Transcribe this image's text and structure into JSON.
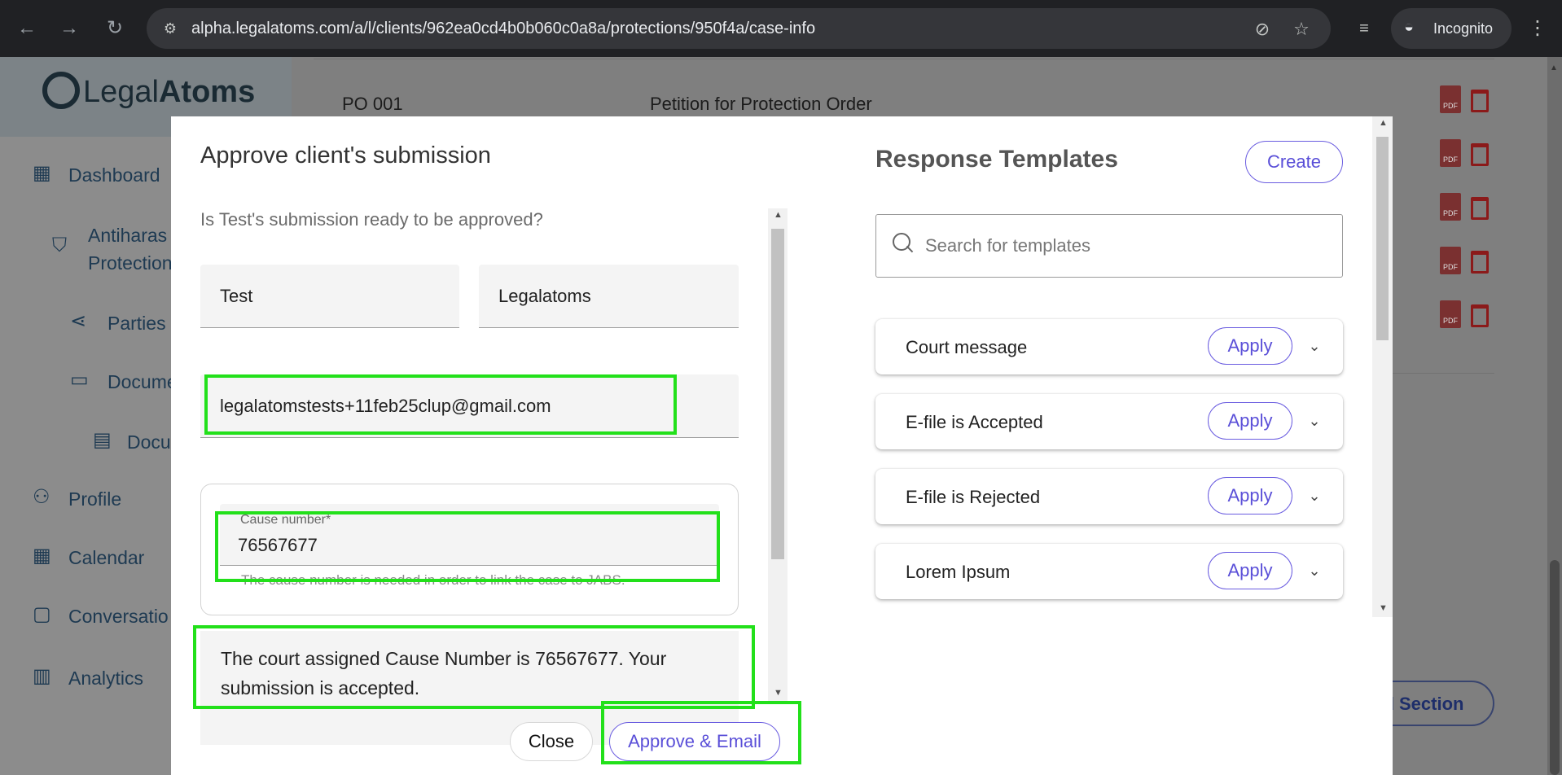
{
  "browser": {
    "url": "alpha.legalatoms.com/a/l/clients/962ea0cd4b0b060c0a8a/protections/950f4a/case-info",
    "incognito_label": "Incognito",
    "icons": {
      "back": "back-arrow-icon",
      "forward": "forward-arrow-icon",
      "reload": "reload-icon",
      "site_settings": "tune-icon",
      "eye_off": "eye-off-icon",
      "bookmark": "star-icon",
      "tab_search": "tab-search-icon",
      "incognito": "incognito-icon",
      "menu": "kebab-menu-icon"
    }
  },
  "sidebar": {
    "logo_light": "Legal",
    "logo_bold": "Atoms",
    "items": [
      {
        "label": "Dashboard",
        "icon": "dashboard-icon"
      },
      {
        "label": "Antiharas",
        "label2": "Protection",
        "icon": "shield-icon"
      },
      {
        "label": "Parties",
        "icon": "share-icon"
      },
      {
        "label": "Docume",
        "icon": "archive-icon"
      },
      {
        "label": "Docu",
        "icon": "document-icon"
      },
      {
        "label": "Profile",
        "icon": "person-icon"
      },
      {
        "label": "Calendar",
        "icon": "calendar-icon"
      },
      {
        "label": "Conversatio",
        "icon": "chat-icon"
      },
      {
        "label": "Analytics",
        "icon": "analytics-icon"
      }
    ]
  },
  "background": {
    "doc_code": "PO 001",
    "doc_name": "Petition for Protection Order",
    "pdf_label": "PDF",
    "add_section_label": "dd Section"
  },
  "modal": {
    "title": "Approve client's submission",
    "question": "Is Test's submission ready to be approved?",
    "first_name": "Test",
    "last_name": "Legalatoms",
    "email": "legalatomstests+11feb25clup@gmail.com",
    "cause_label": "Cause number*",
    "cause_value": "76567677",
    "cause_hint": "The cause number is needed in order to link the case to JABS.",
    "message": "The court assigned Cause Number is 76567677. Your submission is accepted.",
    "close_label": "Close",
    "approve_label": "Approve & Email"
  },
  "templates": {
    "title": "Response Templates",
    "create_label": "Create",
    "search_placeholder": "Search for templates",
    "apply_label": "Apply",
    "items": [
      {
        "name": "Court message"
      },
      {
        "name": "E-file is Accepted"
      },
      {
        "name": "E-file is Rejected"
      },
      {
        "name": "Lorem Ipsum"
      }
    ]
  },
  "colors": {
    "accent": "#5a4fd8",
    "highlight": "#22e01a",
    "chrome_bg": "#202124"
  }
}
